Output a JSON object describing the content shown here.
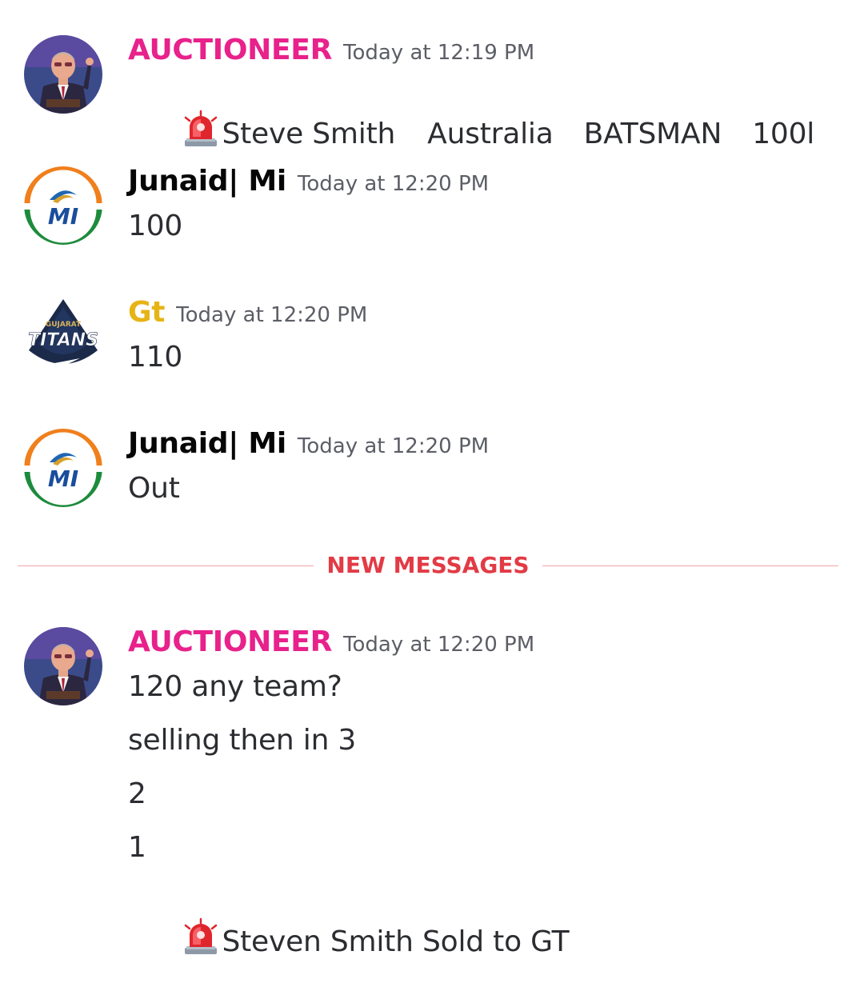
{
  "colors": {
    "auctioneer": "#e8218b",
    "junaid": "#060607",
    "gt": "#e7b416",
    "timestamp": "#5c5e66",
    "new_messages": "#e23b45"
  },
  "messages": [
    {
      "author": "AUCTIONEER",
      "avatar": "auctioneer-avatar",
      "timestamp": "Today at 12:19 PM",
      "lines": [
        {
          "icon": "rotating-light-icon",
          "parts": [
            "Steve Smith",
            "Australia",
            "BATSMAN",
            "100l"
          ]
        }
      ]
    },
    {
      "author": "Junaid| Mi",
      "avatar": "mumbai-indians-logo",
      "timestamp": "Today at 12:20 PM",
      "lines": [
        {
          "text": "100"
        }
      ]
    },
    {
      "author": "Gt",
      "avatar": "gujarat-titans-logo",
      "timestamp": "Today at 12:20 PM",
      "lines": [
        {
          "text": "110"
        }
      ]
    },
    {
      "author": "Junaid| Mi",
      "avatar": "mumbai-indians-logo",
      "timestamp": "Today at 12:20 PM",
      "lines": [
        {
          "text": "Out"
        }
      ]
    }
  ],
  "new_messages_label": "NEW MESSAGES",
  "logo_text": {
    "gt_small": "GUJARAT",
    "gt_big": "TITANS"
  },
  "last_message": {
    "author": "AUCTIONEER",
    "avatar": "auctioneer-avatar",
    "timestamp": "Today at 12:20 PM",
    "lines": [
      {
        "text": "120 any team?"
      },
      {
        "text": "selling then in 3"
      },
      {
        "text": "2"
      },
      {
        "text": "1"
      },
      {
        "icon": "rotating-light-icon",
        "text": "Steven Smith Sold to GT"
      }
    ]
  }
}
